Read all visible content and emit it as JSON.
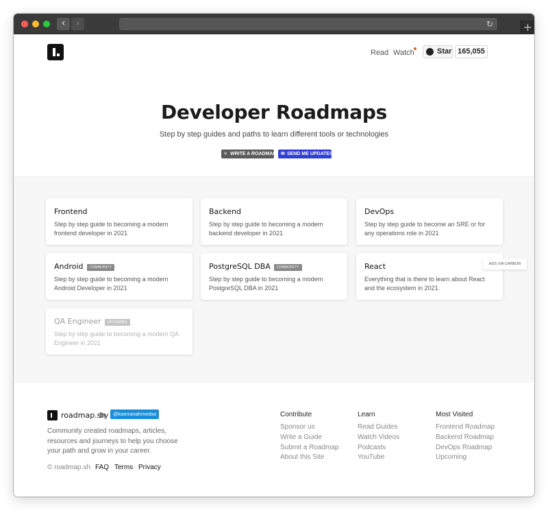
{
  "browser": {
    "back": "‹",
    "forward": "›",
    "reload": "↻",
    "newtab": "+"
  },
  "nav": {
    "read": "Read",
    "watch": "Watch",
    "star": "Star",
    "star_count": "165,055"
  },
  "hero": {
    "title": "Developer Roadmaps",
    "subtitle": "Step by step guides and paths to learn different tools or technologies",
    "write_button": "WRITE A ROADMAP",
    "send_button": "SEND ME UPDATES"
  },
  "roadmaps": [
    {
      "title": "Frontend",
      "badge": "",
      "description": "Step by step guide to becoming a modern frontend developer in 2021"
    },
    {
      "title": "Backend",
      "badge": "",
      "description": "Step by step guide to becoming a modern backend developer in 2021"
    },
    {
      "title": "DevOps",
      "badge": "",
      "description": "Step by step guide to become an SRE or for any operations role in 2021"
    },
    {
      "title": "Android",
      "badge": "COMMUNITY",
      "description": "Step by step guide to becoming a modern Android Developer in 2021"
    },
    {
      "title": "PostgreSQL DBA",
      "badge": "COMMUNITY",
      "description": "Step by step guide to becoming a modern PostgreSQL DBA in 2021"
    },
    {
      "title": "React",
      "badge": "",
      "description": "Everything that is there to learn about React and the ecosystem in 2021."
    },
    {
      "title": "QA Engineer",
      "badge": "UPCOMING",
      "description": "Step by step guide to becoming a modern QA Engineer in 2021"
    }
  ],
  "ads": "ADS VIA CARBON",
  "footer": {
    "brand": "roadmap.sh",
    "by": "by",
    "handle": "@kamranahmedse",
    "description": "Community created roadmaps, articles, resources and journeys to help you choose your path and grow in your career.",
    "copyright": "© roadmap.sh",
    "faq": "FAQ",
    "terms": "Terms",
    "privacy": "Privacy",
    "columns": [
      {
        "heading": "Contribute",
        "links": [
          "Sponsor us",
          "Write a Guide",
          "Submit a Roadmap",
          "About this Site"
        ]
      },
      {
        "heading": "Learn",
        "links": [
          "Read Guides",
          "Watch Videos",
          "Podcasts",
          "YouTube"
        ]
      },
      {
        "heading": "Most Visited",
        "links": [
          "Frontend Roadmap",
          "Backend Roadmap",
          "DevOps Roadmap",
          "Upcoming"
        ]
      }
    ]
  }
}
